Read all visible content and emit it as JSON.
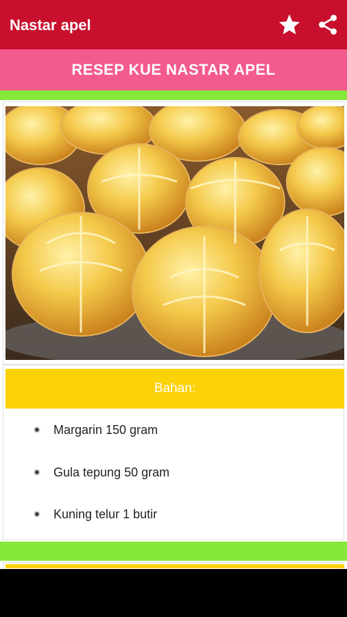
{
  "appbar": {
    "title": "Nastar apel",
    "favorite_icon": "star-icon",
    "share_icon": "share-icon",
    "bg_color": "#c8102e"
  },
  "banner": {
    "title": "RESEP KUE NASTAR APEL",
    "bg_color": "#f45b8d"
  },
  "section": {
    "header": "Bahan:",
    "header_color": "#fcd208",
    "bullet_icon": "star-bullet-icon",
    "items": [
      "Margarin 150 gram",
      "Gula tepung 50 gram",
      "Kuning telur 1 butir"
    ]
  },
  "accent_green": "#86e83a"
}
